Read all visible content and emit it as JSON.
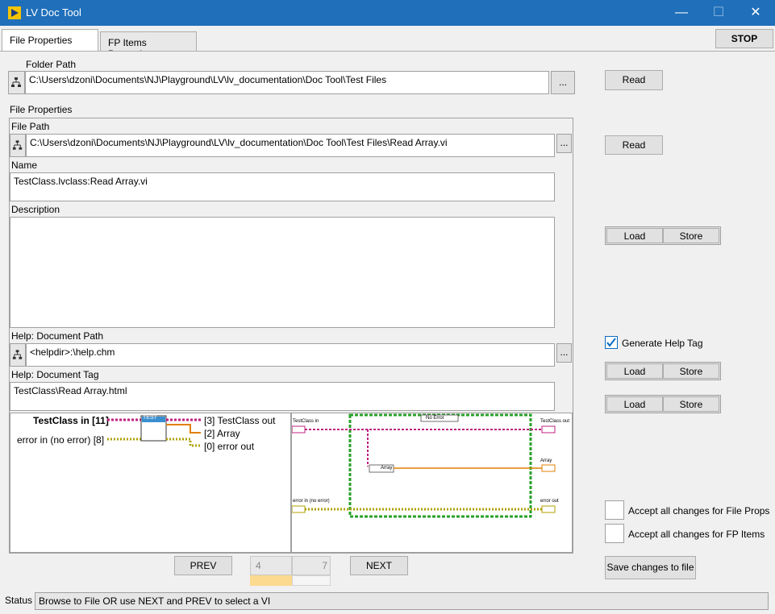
{
  "window": {
    "title": "LV Doc Tool",
    "minimize": "—",
    "maximize": "☐",
    "close": "✕"
  },
  "tabs": [
    "File Properties",
    "FP Items Properties"
  ],
  "stop_label": "STOP",
  "folder": {
    "label": "Folder Path",
    "value": "C:\\Users\\dzoni\\Documents\\NJ\\Playground\\LV\\lv_documentation\\Doc Tool\\Test Files",
    "browse_label": "...",
    "read_label": "Read"
  },
  "file_props": {
    "group_label": "File Properties",
    "file_path_label": "File Path",
    "file_path": "C:\\Users\\dzoni\\Documents\\NJ\\Playground\\LV\\lv_documentation\\Doc Tool\\Test Files\\Read Array.vi",
    "browse_label": "...",
    "read_label": "Read",
    "name_label": "Name",
    "name": "TestClass.lvclass:Read Array.vi",
    "description_label": "Description",
    "description": "",
    "help_path_label": "Help: Document Path",
    "help_path": "<helpdir>:\\help.chm",
    "help_tag_label": "Help: Document Tag",
    "help_tag": "TestClass\\Read Array.html"
  },
  "connector": {
    "left_inputs": [
      "TestClass in [11]",
      "error in (no error) [8]"
    ],
    "right_outputs": [
      "[3] TestClass out",
      "[2] Array",
      "[0] error out"
    ],
    "icon_text": "TEST"
  },
  "block_diagram": {
    "labels": [
      "TestClass in",
      "TestClass out",
      "Array",
      "error in (no error)",
      "error out",
      "No Error",
      "Array"
    ]
  },
  "desc_buttons": {
    "load": "Load",
    "store": "Store"
  },
  "generate_help_tag": {
    "label": "Generate Help Tag",
    "checked": true
  },
  "help_path_buttons": {
    "load": "Load",
    "store": "Store"
  },
  "help_tag_buttons": {
    "load": "Load",
    "store": "Store"
  },
  "accept_file_props": {
    "label": "Accept all changes for File Props",
    "checked": false
  },
  "accept_fp_items": {
    "label": "Accept all changes for FP Items",
    "checked": false
  },
  "save_label": "Save changes to file",
  "nav": {
    "prev_label": "PREV",
    "next_label": "NEXT",
    "current": "4",
    "total": "7"
  },
  "status": {
    "label": "Status",
    "text": "Browse to File OR use NEXT and PREV to select a VI"
  },
  "colors": {
    "titlebar": "#1f6fba",
    "class_wire": "#c02080",
    "array_wire": "#e08000",
    "error_wire": "#b0a000",
    "case_border": "#28a028"
  }
}
